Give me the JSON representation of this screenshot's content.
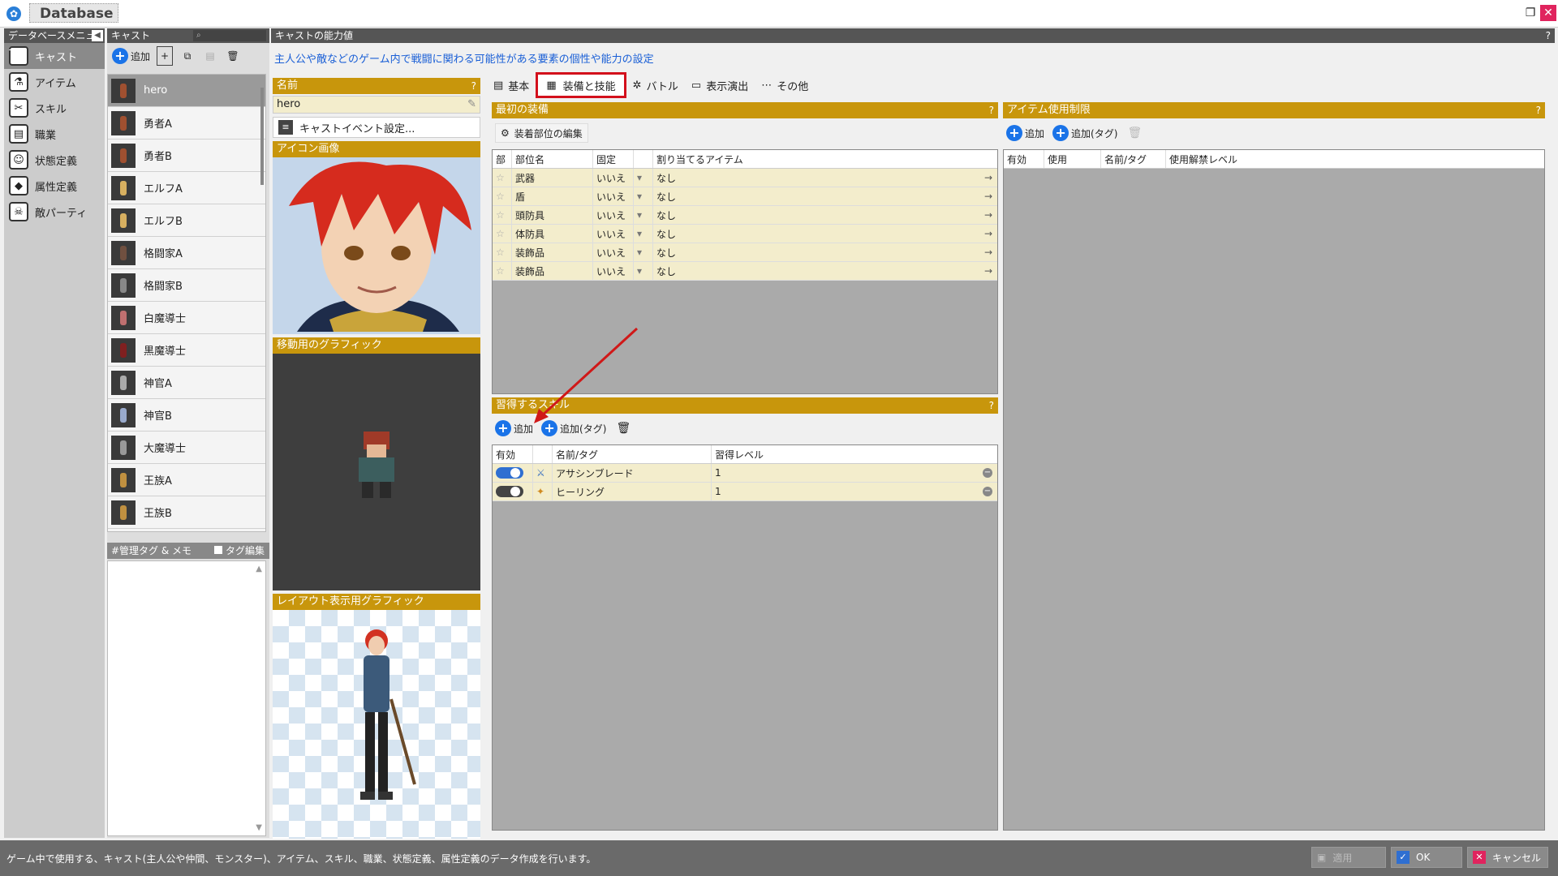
{
  "window": {
    "title": "Database",
    "restore_icon": "restore-icon",
    "close_icon": "close-icon"
  },
  "menu": {
    "header": "データベースメニュー",
    "items": [
      {
        "label": "キャスト",
        "icon": "cast-icon"
      },
      {
        "label": "アイテム",
        "icon": "item-icon"
      },
      {
        "label": "スキル",
        "icon": "skill-icon"
      },
      {
        "label": "職業",
        "icon": "class-icon"
      },
      {
        "label": "状態定義",
        "icon": "state-icon"
      },
      {
        "label": "属性定義",
        "icon": "attribute-icon"
      },
      {
        "label": "敵パーティ",
        "icon": "enemy-party-icon"
      }
    ]
  },
  "cast": {
    "header": "キャスト",
    "add_label": "追加",
    "items": [
      "hero",
      "勇者A",
      "勇者B",
      "エルフA",
      "エルフB",
      "格闘家A",
      "格闘家B",
      "白魔導士",
      "黒魔導士",
      "神官A",
      "神官B",
      "大魔導士",
      "王族A",
      "王族B"
    ],
    "selected": "hero",
    "tag_header": "#管理タグ & メモ",
    "tag_edit": "タグ編集"
  },
  "caption": {
    "header": "キャストの能力値",
    "description": "主人公や敵などのゲーム内で戦闘に関わる可能性がある要素の個性や能力の設定"
  },
  "profile": {
    "name_header": "名前",
    "name_value": "hero",
    "event_button": "キャストイベント設定...",
    "icon_header": "アイコン画像",
    "move_header": "移動用のグラフィック",
    "layout_header": "レイアウト表示用グラフィック"
  },
  "tabs": [
    "基本",
    "装備と技能",
    "バトル",
    "表示演出",
    "その他"
  ],
  "active_tab": "装備と技能",
  "equipment": {
    "header": "最初の装備",
    "edit_button": "装着部位の編集",
    "columns": [
      "部",
      "部位名",
      "固定",
      "",
      "割り当てるアイテム"
    ],
    "rows": [
      {
        "part": "武器",
        "fixed": "いいえ",
        "item": "なし"
      },
      {
        "part": "盾",
        "fixed": "いいえ",
        "item": "なし"
      },
      {
        "part": "頭防具",
        "fixed": "いいえ",
        "item": "なし"
      },
      {
        "part": "体防具",
        "fixed": "いいえ",
        "item": "なし"
      },
      {
        "part": "装飾品",
        "fixed": "いいえ",
        "item": "なし"
      },
      {
        "part": "装飾品",
        "fixed": "いいえ",
        "item": "なし"
      }
    ]
  },
  "skills": {
    "header": "習得するスキル",
    "add_label": "追加",
    "add_tag_label": "追加(タグ)",
    "columns": [
      "有効",
      "",
      "名前/タグ",
      "習得レベル"
    ],
    "rows": [
      {
        "name": "アサシンブレード",
        "level": "1",
        "icon": "sword-icon"
      },
      {
        "name": "ヒーリング",
        "level": "1",
        "icon": "heal-icon"
      }
    ]
  },
  "item_restriction": {
    "header": "アイテム使用制限",
    "add_label": "追加",
    "add_tag_label": "追加(タグ)",
    "columns": [
      "有効",
      "使用",
      "名前/タグ",
      "使用解禁レベル"
    ]
  },
  "status": {
    "text": "ゲーム中で使用する、キャスト(主人公や仲間、モンスター)、アイテム、スキル、職業、状態定義、属性定義のデータ作成を行います。",
    "apply": "適用",
    "ok": "OK",
    "cancel": "キャンセル"
  },
  "colors": {
    "gold": "#c8960c",
    "highlight_red": "#d3101c",
    "arrow_red": "#d01818",
    "accent_blue": "#1a73e8"
  }
}
